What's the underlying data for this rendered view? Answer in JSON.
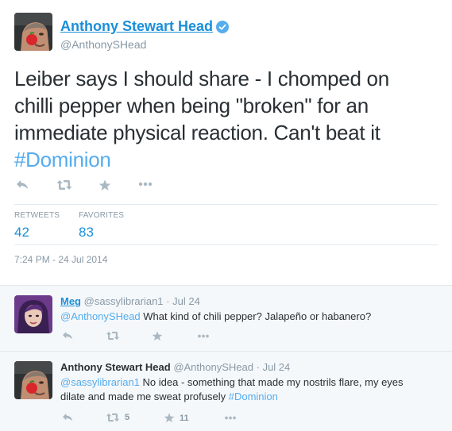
{
  "main_tweet": {
    "author_name": "Anthony Stewart Head",
    "handle": "@AnthonySHead",
    "text_line_1": "Leiber says I should share - I chomped on",
    "text_line_2": "chilli pepper when being \"broken\" for an",
    "text_line_3": "immediate physical reaction. Can't beat it",
    "hashtag": "#Dominion",
    "stats": {
      "retweets_label": "RETWEETS",
      "retweets_value": "42",
      "favorites_label": "FAVORITES",
      "favorites_value": "83"
    },
    "timestamp": "7:24 PM - 24 Jul 2014"
  },
  "replies": [
    {
      "name": "Meg",
      "handle": "@sassylibrarian1",
      "dot": "·",
      "date": "Jul 24",
      "mention": "@AnthonySHead",
      "text": " What kind of chili pepper? Jalapeño or habanero?"
    },
    {
      "name": "Anthony Stewart Head",
      "handle": "@AnthonySHead",
      "dot": "·",
      "date": "Jul 24",
      "mention": "@sassylibrarian1",
      "text_1": " No idea - something that made my nostrils flare, my eyes",
      "text_2": "dilate and made me sweat profusely ",
      "hashtag": "#Dominion",
      "retweet_count": "5",
      "favorite_count": "11"
    }
  ],
  "icons": {
    "reply": "reply-icon",
    "retweet": "retweet-icon",
    "favorite": "star-icon",
    "more": "more-icon",
    "verified": "verified-badge-icon"
  },
  "colors": {
    "link": "#1a8fd8",
    "hashtag": "#55acee",
    "muted": "#8899a6",
    "icon": "#aab8c2",
    "reply_bg": "#f5f8fa",
    "divider": "#e1e8ed"
  }
}
